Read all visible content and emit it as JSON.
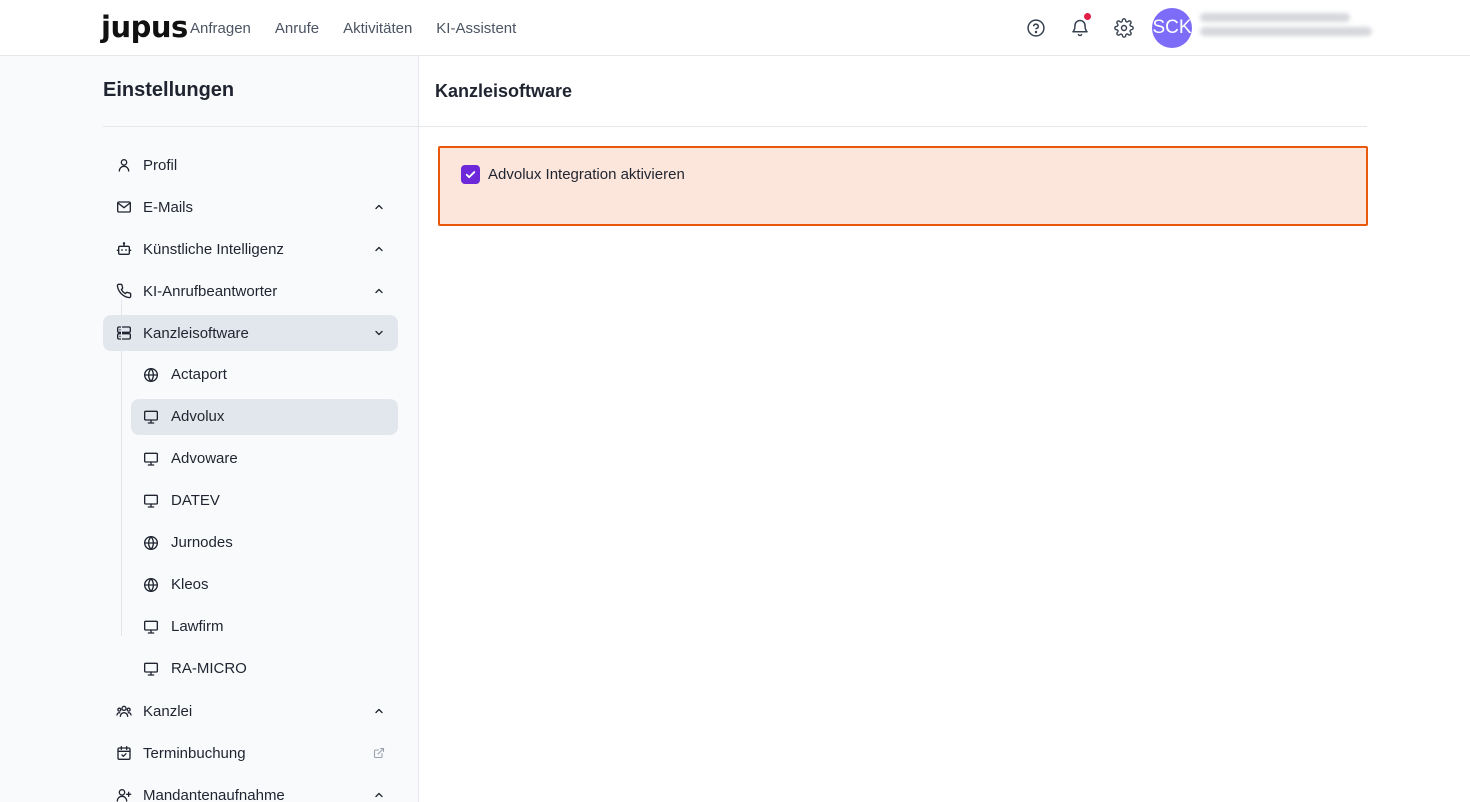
{
  "header": {
    "logo": "jupus",
    "nav": [
      "Anfragen",
      "Anrufe",
      "Aktivitäten",
      "KI-Assistent"
    ],
    "avatar_initials": "SCK",
    "accent_color": "#7c6cf7"
  },
  "sidebar": {
    "title": "Einstellungen",
    "items": [
      {
        "label": "Profil",
        "icon": "user-icon"
      },
      {
        "label": "E-Mails",
        "icon": "mail-icon",
        "chevron": "up"
      },
      {
        "label": "Künstliche Intelligenz",
        "icon": "bot-icon",
        "chevron": "up"
      },
      {
        "label": "KI-Anrufbeantworter",
        "icon": "phone-icon",
        "chevron": "up"
      },
      {
        "label": "Kanzleisoftware",
        "icon": "server-icon",
        "chevron": "down",
        "active": true
      },
      {
        "label": "Kanzlei",
        "icon": "users-icon",
        "chevron": "up"
      },
      {
        "label": "Terminbuchung",
        "icon": "calendar-check-icon",
        "external": true
      },
      {
        "label": "Mandantenaufnahme",
        "icon": "user-plus-icon",
        "chevron": "up"
      }
    ],
    "subitems": [
      {
        "label": "Actaport",
        "icon": "globe-icon"
      },
      {
        "label": "Advolux",
        "icon": "monitor-icon",
        "active": true
      },
      {
        "label": "Advoware",
        "icon": "monitor-icon"
      },
      {
        "label": "DATEV",
        "icon": "monitor-icon"
      },
      {
        "label": "Jurnodes",
        "icon": "globe-icon"
      },
      {
        "label": "Kleos",
        "icon": "globe-icon"
      },
      {
        "label": "Lawfirm",
        "icon": "monitor-icon"
      },
      {
        "label": "RA-MICRO",
        "icon": "monitor-icon"
      }
    ]
  },
  "main": {
    "title": "Kanzleisoftware",
    "integration": {
      "label": "Advolux Integration aktivieren",
      "checked": true,
      "checkbox_color": "#6d28d9",
      "highlight_border": "#ea580c",
      "highlight_bg": "#fce6dc"
    }
  }
}
